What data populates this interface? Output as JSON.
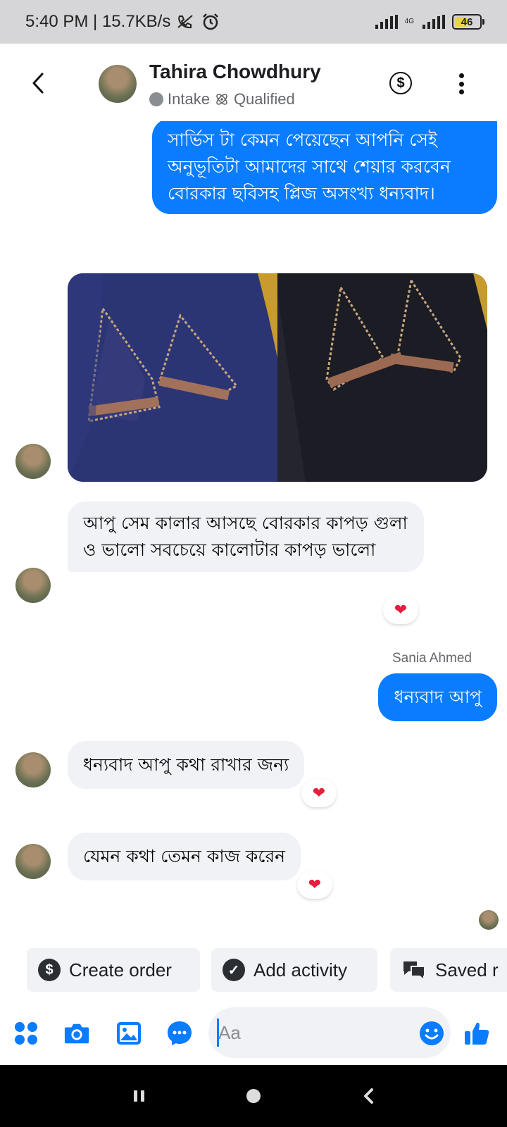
{
  "status_bar": {
    "time": "5:40 PM | 15.7KB/s",
    "network": "4G",
    "battery": "46"
  },
  "header": {
    "contact_name": "Tahira Chowdhury",
    "tag_intake": "Intake",
    "tag_qualified": "Qualified",
    "dollar_symbol": "$"
  },
  "messages": {
    "m1_outgoing": "সার্ভিস টা কেমন পেয়েছেন আপনি সেই অনুভূতিটা আমাদের সাথে শেয়ার করবেন বোরকার ছবিসহ  প্লিজ অসংখ্য ধন্যবাদ।",
    "m2_incoming": "আপু সেম কালার আসছে বোরকার কাপড় গুলা ও ভালো সবচেয়ে কালোটার কাপড় ভালো",
    "sender_name": "Sania Ahmed",
    "m3_outgoing": "ধন্যবাদ আপু",
    "m4_incoming": "ধন্যবাদ আপু কথা রাখার জন্য",
    "m5_incoming": "যেমন কথা তেমন কাজ করেন",
    "reaction": "❤"
  },
  "quick_actions": {
    "create_order": "Create order",
    "add_activity": "Add activity",
    "saved_replies": "Saved r",
    "dollar_symbol": "$",
    "check_symbol": "✓"
  },
  "composer": {
    "placeholder": "Aa"
  },
  "colors": {
    "messenger_blue": "#0a7cff",
    "incoming_bubble": "#f0f2f5",
    "heart_red": "#e41e3f"
  }
}
